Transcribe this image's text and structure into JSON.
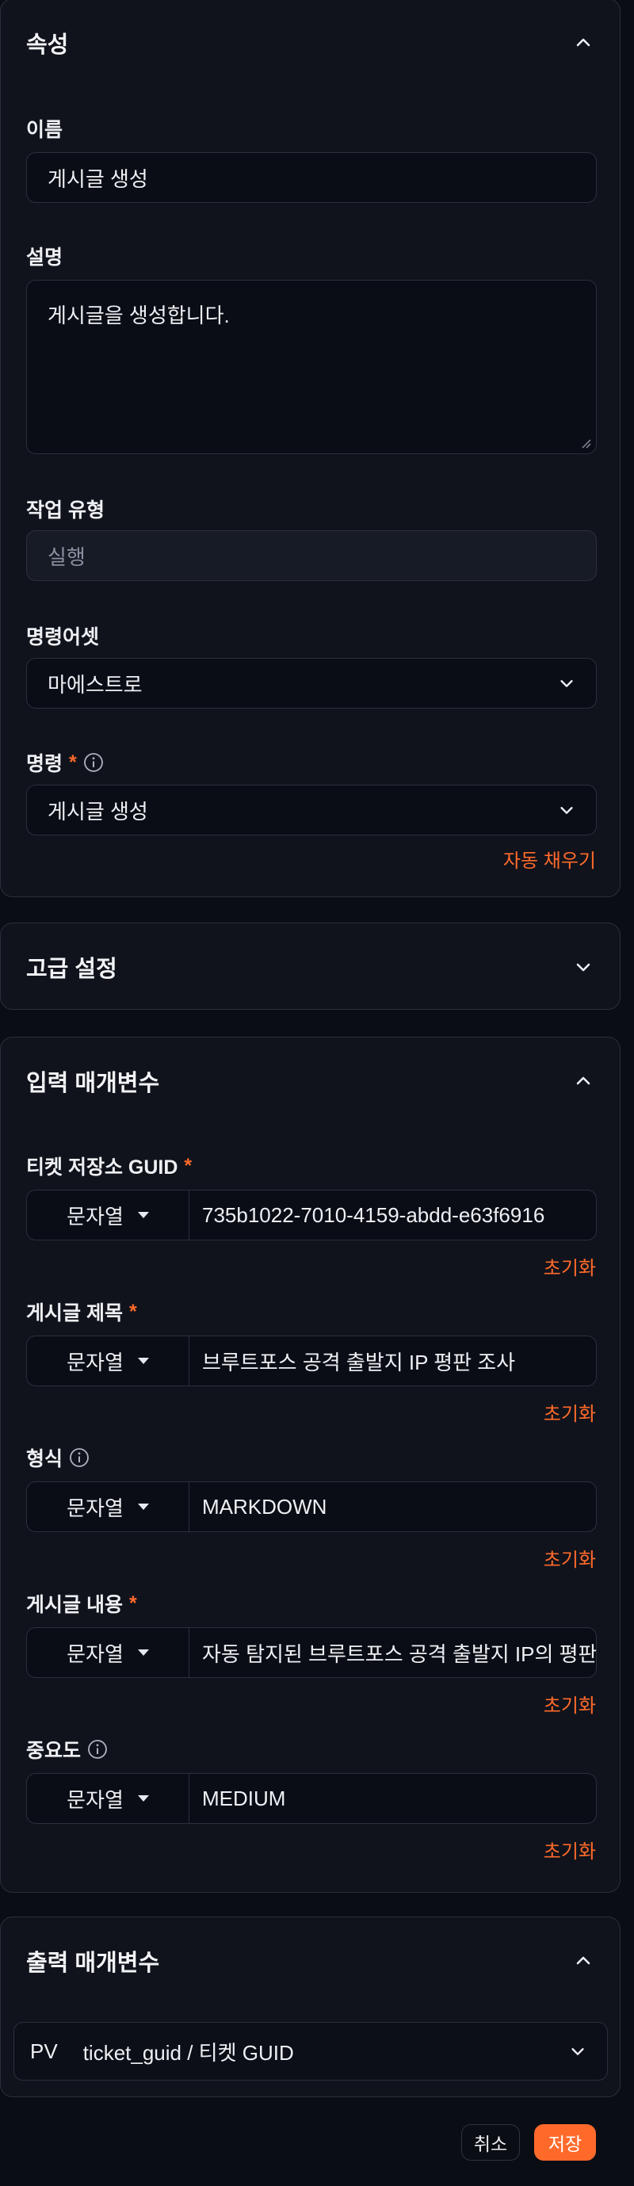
{
  "properties": {
    "title": "속성",
    "name_label": "이름",
    "name_value": "게시글 생성",
    "description_label": "설명",
    "description_value": "게시글을 생성합니다.",
    "task_type_label": "작업 유형",
    "task_type_value": "실행",
    "command_asset_label": "명령어셋",
    "command_asset_value": "마에스트로",
    "command_label": "명령",
    "command_value": "게시글 생성",
    "autofill_label": "자동 채우기"
  },
  "advanced": {
    "title": "고급 설정"
  },
  "inputs": {
    "title": "입력 매개변수",
    "reset_label": "초기화",
    "params": [
      {
        "label": "티켓 저장소 GUID",
        "type": "문자열",
        "value": "735b1022-7010-4159-abdd-e63f6916"
      },
      {
        "label": "게시글 제목",
        "type": "문자열",
        "value": "브루트포스 공격 출발지 IP 평판 조사"
      },
      {
        "label": "형식",
        "type": "문자열",
        "value": "MARKDOWN"
      },
      {
        "label": "게시글 내용",
        "type": "문자열",
        "value": "자동 탐지된 브루트포스 공격 출발지 IP의 평판"
      },
      {
        "label": "중요도",
        "type": "문자열",
        "value": "MEDIUM"
      }
    ]
  },
  "outputs": {
    "title": "출력 매개변수",
    "item_tag": "PV",
    "item_value": "ticket_guid / 티켓 GUID"
  },
  "footer": {
    "cancel_label": "취소",
    "save_label": "저장"
  },
  "colors": {
    "accent": "#ff6a2b",
    "panel": "#10131b",
    "field": "#0a0d15"
  }
}
